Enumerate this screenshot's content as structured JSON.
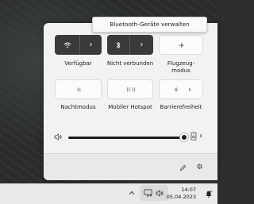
{
  "tooltip": "Bluetooth-Geräte verwalten",
  "tiles": [
    {
      "label": "Verfügbar",
      "state": "on",
      "icon": "wifi-icon",
      "has_chevron": true
    },
    {
      "label": "Nicht verbunden",
      "state": "on",
      "icon": "bluetooth-icon",
      "has_chevron": true
    },
    {
      "label": "Flugzeug-\nmodus",
      "state": "off",
      "icon": "airplane-icon",
      "has_chevron": false
    },
    {
      "label": "Nachtmodus",
      "state": "off",
      "icon": "night-light-icon",
      "has_chevron": false
    },
    {
      "label": "Mobiler Hotspot",
      "state": "off",
      "icon": "hotspot-icon",
      "has_chevron": false
    },
    {
      "label": "Barrierefreiheit",
      "state": "off",
      "icon": "accessibility-icon",
      "has_chevron": true
    }
  ],
  "glyphs": {
    "chevron": "›",
    "wifi": "ᯤ",
    "bluetooth": "ᛒ",
    "airplane": "✈",
    "night": "☼",
    "hotspot": "((·))",
    "accessibility": "☥",
    "volume": "🕪",
    "pencil": "✎",
    "gear": "⚙",
    "caret_up": "^",
    "network": "🖵",
    "bell": "🔔"
  },
  "volume": {
    "level_fraction": 0.98
  },
  "taskbar": {
    "time": "14:07",
    "date": "05.04.2023"
  },
  "colors": {
    "tile_on": "#3a3a3a",
    "panel_bg": "#f1f2f3"
  }
}
